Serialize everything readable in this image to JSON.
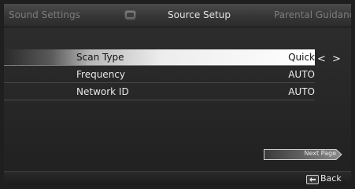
{
  "tabs": {
    "left": "Sound Settings",
    "center": "Source Setup",
    "right": "Parental Guidance",
    "center_icon": "source-setup-icon"
  },
  "menu": {
    "rows": [
      {
        "label": "Scan Type",
        "value": "Quick",
        "selected": true
      },
      {
        "label": "Frequency",
        "value": "AUTO",
        "selected": false
      },
      {
        "label": "Network ID",
        "value": "AUTO",
        "selected": false
      }
    ],
    "value_arrows": "< >"
  },
  "next_page": "Next Page",
  "footer": {
    "back_label": "Back",
    "back_icon": "back-key-icon"
  }
}
